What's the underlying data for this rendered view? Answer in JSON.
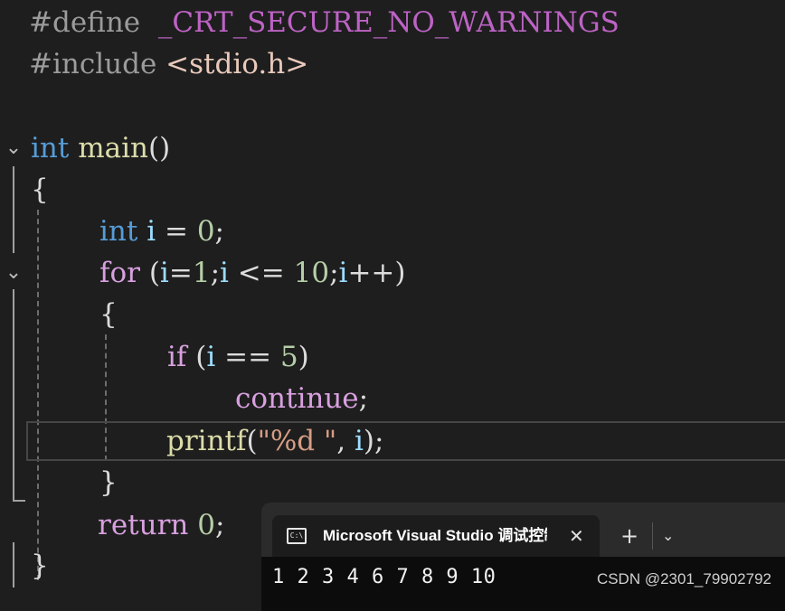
{
  "editor": {
    "lines": [
      {
        "pp": "#define",
        "macro": "_CRT_SECURE_NO_WARNINGS"
      },
      {
        "pp": "#include",
        "inc": "<stdio.h>"
      },
      {},
      {
        "type": "int",
        "fn": "main",
        "rest": "()"
      },
      {
        "brace": "{"
      },
      {
        "type": "int",
        "var": "i",
        "eq": " = ",
        "num": "0",
        "semi": ";"
      },
      {
        "kw": "for",
        "p1": " (",
        "v1": "i",
        "a": "=",
        "n1": "1",
        "s1": ";",
        "v2": "i",
        "op": " <= ",
        "n2": "10",
        "s2": ";",
        "v3": "i",
        "inc": "++)"
      },
      {
        "brace": "{"
      },
      {
        "kw": "if",
        "p1": " (",
        "v1": "i",
        "op": " == ",
        "n1": "5",
        "p2": ")"
      },
      {
        "kw": "continue",
        "semi": ";"
      },
      {
        "fn": "printf",
        "p1": "(",
        "str": "\"%d \"",
        "c": ", ",
        "v1": "i",
        "p2": ");"
      },
      {
        "brace": "}"
      },
      {
        "kw": "return",
        "num": "0",
        "semi": ";"
      },
      {
        "brace": "}"
      }
    ]
  },
  "console": {
    "tab_title": "Microsoft Visual Studio 调试控制台",
    "tab_icon_text": "C:\\",
    "close_symbol": "✕",
    "new_tab_symbol": "+",
    "dropdown_symbol": "⌄",
    "output": "1 2 3 4 6 7 8 9 10"
  },
  "watermark": "CSDN @2301_79902792",
  "colors": {
    "background": "#1e1e1e",
    "keyword_blue": "#569cd6",
    "keyword_purple": "#d8a0df",
    "function": "#dcdcaa",
    "variable": "#9cdcfe",
    "number": "#b5cea8",
    "string": "#d69d85"
  }
}
